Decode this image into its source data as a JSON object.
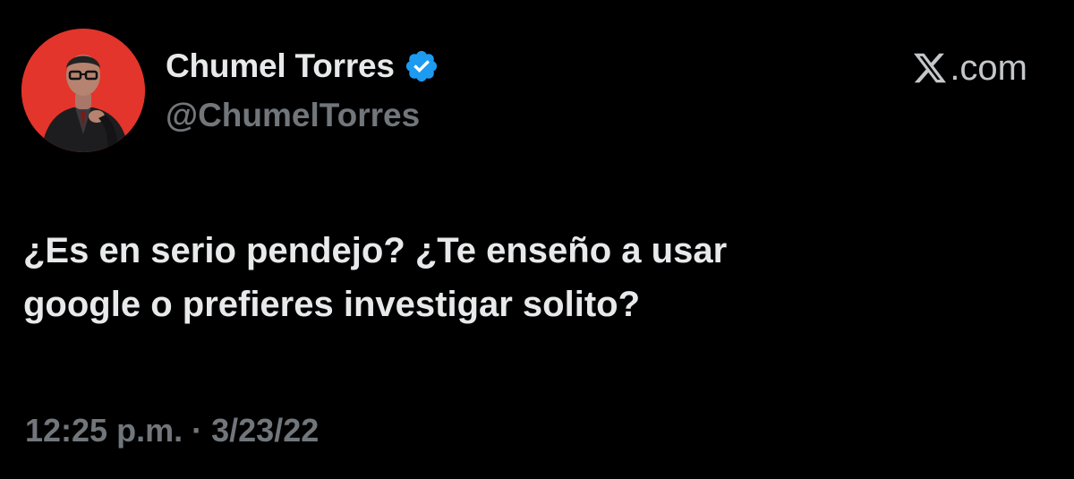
{
  "author": {
    "display_name": "Chumel Torres",
    "handle": "@ChumelTorres",
    "verified": true,
    "avatar_icon": "person-portrait-avatar",
    "avatar_bg_color": "#e3352b"
  },
  "brand": {
    "icon": "x-logo-icon",
    "text": ".com"
  },
  "tweet": {
    "lines": [
      "¿Es en serio pendejo? ¿Te enseño a usar",
      "google o prefieres investigar solito?"
    ]
  },
  "meta": {
    "time": "12:25 p.m.",
    "separator": "·",
    "date": "3/23/22"
  },
  "colors": {
    "background": "#000000",
    "primary_text": "#e7e9ea",
    "secondary_text": "#71767b",
    "verified_blue": "#1d9bf0"
  }
}
